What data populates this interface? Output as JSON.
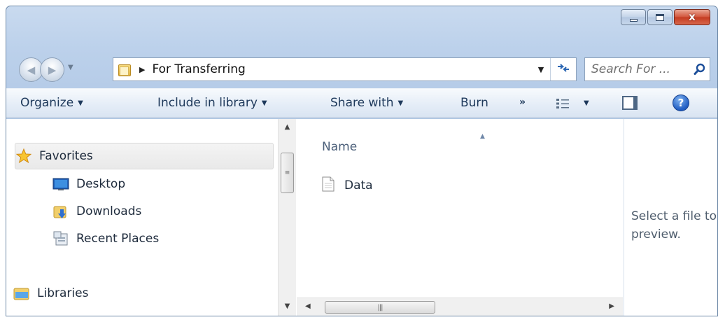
{
  "window": {
    "caption": {
      "minimize_icon": "minimize-icon",
      "maximize_icon": "maximize-icon",
      "close_glyph": "x"
    }
  },
  "nav": {
    "back_glyph": "◀",
    "forward_glyph": "▶",
    "address": "For Transferring",
    "search_placeholder": "Search For ..."
  },
  "toolbar": {
    "organize": "Organize",
    "include_in_library": "Include in library",
    "share_with": "Share with",
    "burn": "Burn",
    "more": "»",
    "help": "?"
  },
  "sidebar": {
    "items": [
      {
        "label": "Favorites",
        "icon": "star-icon",
        "selected": true
      },
      {
        "label": "Desktop",
        "icon": "desktop-icon"
      },
      {
        "label": "Downloads",
        "icon": "downloads-folder-icon"
      },
      {
        "label": "Recent Places",
        "icon": "recent-places-icon"
      },
      {
        "label": "Libraries",
        "icon": "libraries-icon"
      }
    ]
  },
  "files": {
    "column_name": "Name",
    "items": [
      {
        "name": "Data",
        "icon": "document-icon"
      }
    ]
  },
  "preview": {
    "message": "Select a file to preview."
  },
  "colors": {
    "frame": "#bcd1eb",
    "command_bar": "#e5edf7",
    "text_primary": "#1e395b",
    "close_button": "#c9462a"
  }
}
